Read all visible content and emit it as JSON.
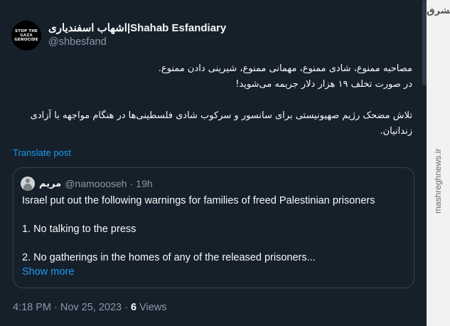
{
  "author": {
    "display_name": "اشهاب اسفندیاری|Shahab Esfandiary",
    "handle": "@shbesfand",
    "avatar_text": [
      "STOP THE",
      "GAZA",
      "GENOCIDE"
    ]
  },
  "tweet": {
    "lines": [
      "مصاحبه ممنوع، شادی ممنوع، مهمانی ممنوع، شیرینی دادن ممنوع.",
      "در صورت تخلف ۱۹ هزار دلار جریمه می‌شوید!",
      "",
      "تلاش مضحک رژیم صهیونیستی برای سانسور و سرکوب شادی فلسطینی‌ها در هنگام مواجهه با آزادی",
      "زندانیان."
    ],
    "translate_label": "Translate post"
  },
  "quote": {
    "name": "مریم",
    "handle": "@namoooseh",
    "separator": "·",
    "time": "19h",
    "paragraphs": [
      "Israel put out the following warnings for families of freed Palestinian prisoners",
      "",
      "1. No talking to the press",
      "",
      "2. No gatherings in the homes of any of the released prisoners..."
    ],
    "show_more_label": "Show more"
  },
  "meta": {
    "time": "4:18 PM",
    "separator": "·",
    "date": "Nov 25, 2023",
    "views_count": "6",
    "views_label": "Views"
  },
  "watermark": {
    "logo_text": "مشرق",
    "site": "mashreghnews.ir"
  },
  "colors": {
    "background": "#15202b",
    "accent": "#1d9bf0",
    "muted": "#8b98a5",
    "border": "#38444d"
  }
}
